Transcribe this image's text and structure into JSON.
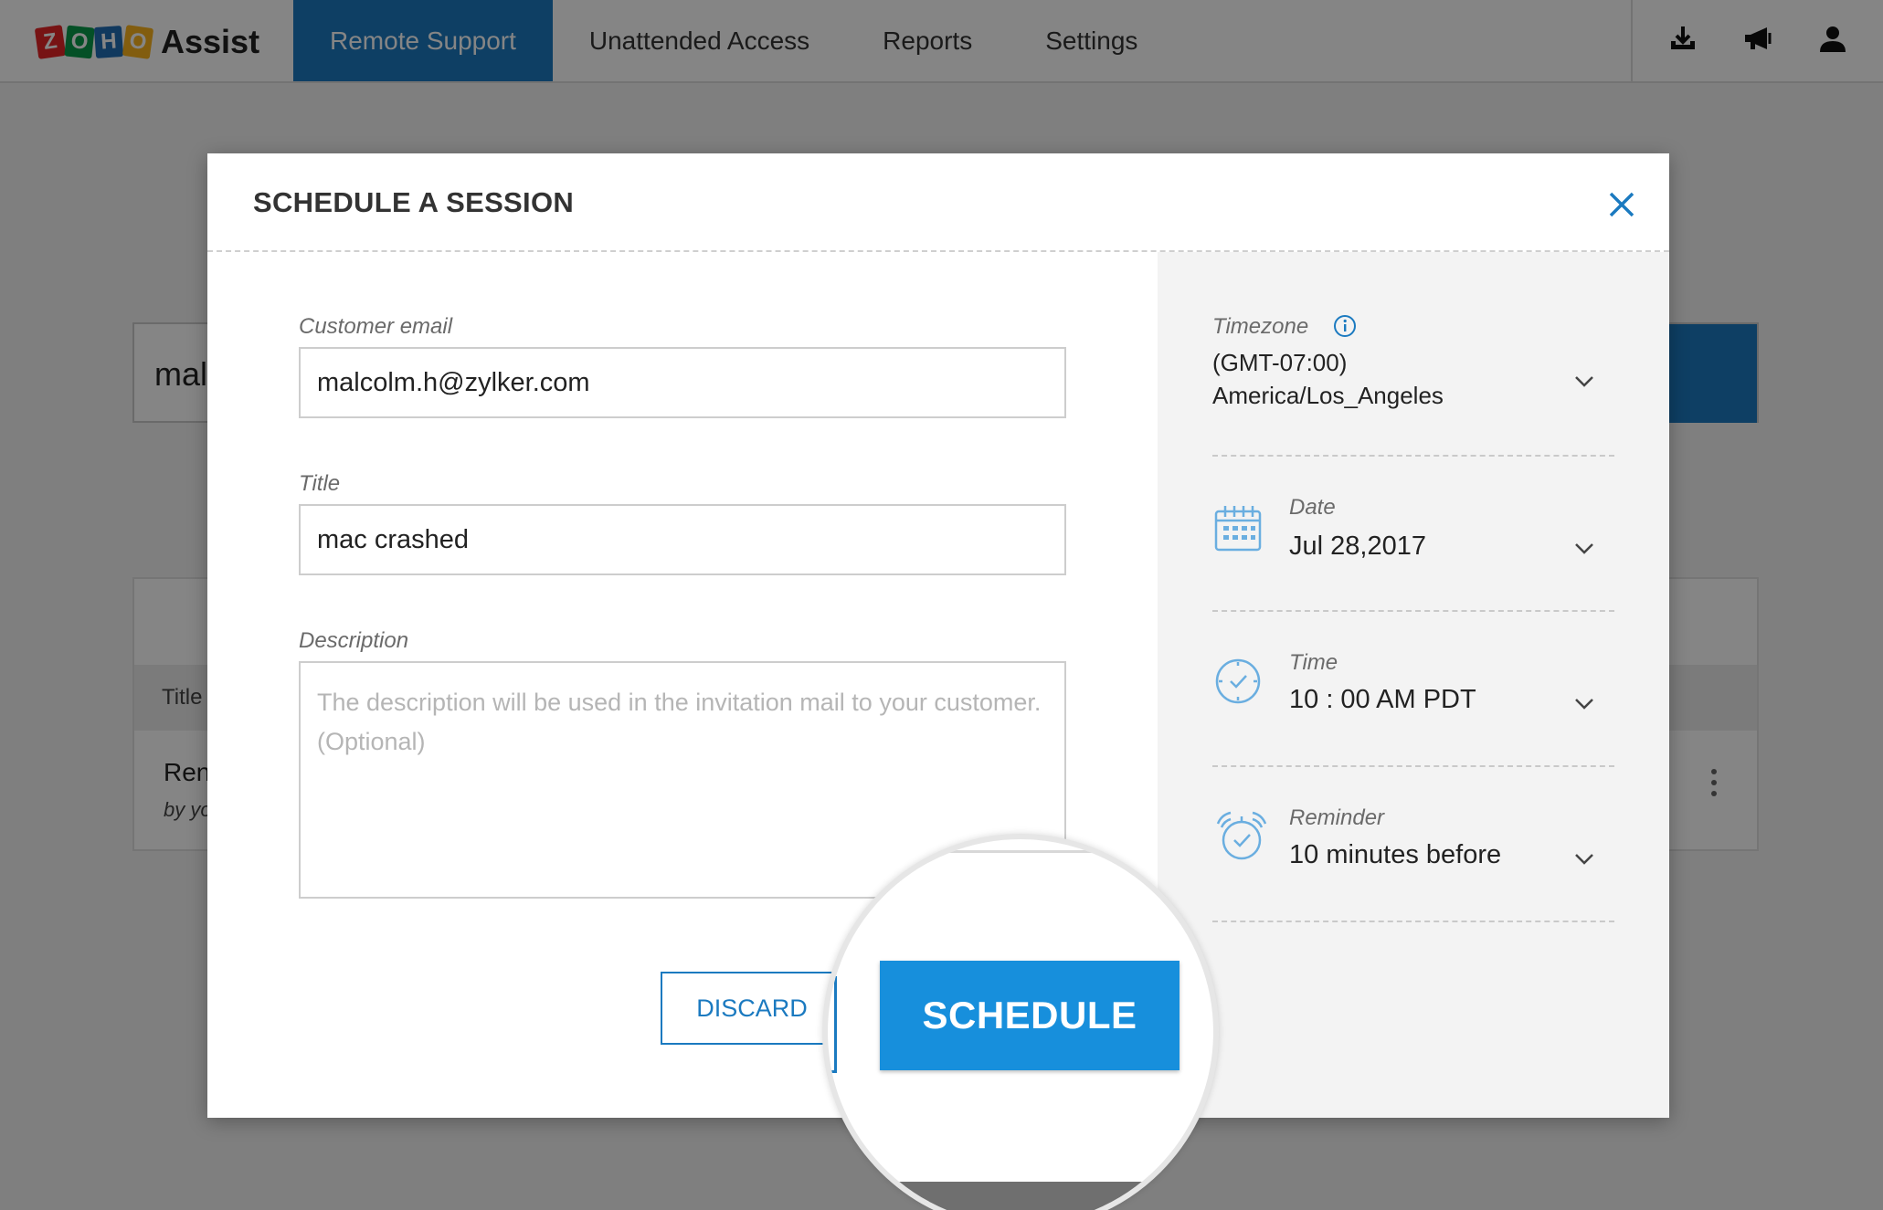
{
  "app": {
    "logo_letters": [
      "Z",
      "O",
      "H",
      "O"
    ],
    "brand": "Assist"
  },
  "nav": {
    "tabs": [
      {
        "label": "Remote Support",
        "active": true
      },
      {
        "label": "Unattended Access",
        "active": false
      },
      {
        "label": "Reports",
        "active": false
      },
      {
        "label": "Settings",
        "active": false
      }
    ],
    "icons": [
      "download-icon",
      "announcement-icon",
      "user-icon"
    ]
  },
  "background": {
    "search_text": "mal",
    "table_header_first": "Title",
    "row_title": "Ren",
    "row_byline": "by yo"
  },
  "modal": {
    "title": "SCHEDULE A SESSION",
    "customer_email": {
      "label": "Customer email",
      "value": "malcolm.h@zylker.com"
    },
    "title_field": {
      "label": "Title",
      "value": "mac crashed"
    },
    "description": {
      "label": "Description",
      "value": "",
      "placeholder": "The description will be used in the invitation mail to your customer. (Optional)"
    },
    "discard_label": "DISCARD",
    "schedule_label": "SCHEDULE",
    "side": {
      "timezone": {
        "label": "Timezone",
        "value_line1": "(GMT-07:00)",
        "value_line2": "America/Los_Angeles"
      },
      "date": {
        "label": "Date",
        "value": "Jul 28,2017"
      },
      "time": {
        "label": "Time",
        "value": "10 : 00 AM PDT"
      },
      "reminder": {
        "label": "Reminder",
        "value": "10 minutes before"
      }
    }
  },
  "colors": {
    "accent": "#1b7ac0",
    "schedule_button": "#178fdc",
    "overlay": "rgba(0,0,0,0.48)"
  }
}
